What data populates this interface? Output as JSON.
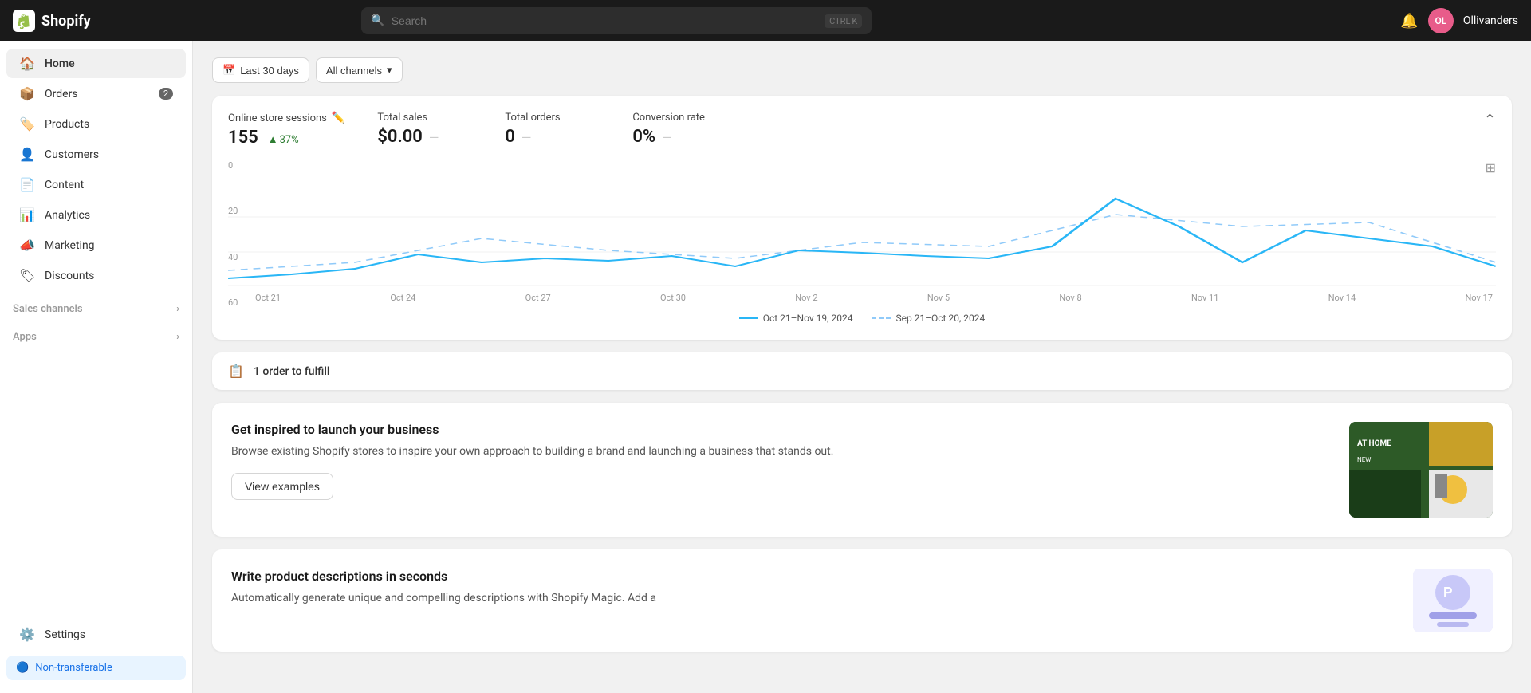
{
  "topbar": {
    "brand_name": "Shopify",
    "search_placeholder": "Search",
    "search_shortcut_key1": "CTRL",
    "search_shortcut_key2": "K",
    "user_initials": "OL",
    "user_name": "Ollivanders"
  },
  "sidebar": {
    "items": [
      {
        "id": "home",
        "label": "Home",
        "icon": "🏠",
        "badge": null
      },
      {
        "id": "orders",
        "label": "Orders",
        "icon": "📦",
        "badge": "2"
      },
      {
        "id": "products",
        "label": "Products",
        "icon": "🏷️",
        "badge": null
      },
      {
        "id": "customers",
        "label": "Customers",
        "icon": "👤",
        "badge": null
      },
      {
        "id": "content",
        "label": "Content",
        "icon": "📄",
        "badge": null
      },
      {
        "id": "analytics",
        "label": "Analytics",
        "icon": "📊",
        "badge": null
      },
      {
        "id": "marketing",
        "label": "Marketing",
        "icon": "📣",
        "badge": null
      },
      {
        "id": "discounts",
        "label": "Discounts",
        "icon": "🏷",
        "badge": null
      }
    ],
    "sales_channels_label": "Sales channels",
    "apps_label": "Apps",
    "settings_label": "Settings",
    "non_transferable_label": "Non-transferable"
  },
  "filters": {
    "date_range": "Last 30 days",
    "channel": "All channels"
  },
  "stats": {
    "online_sessions_label": "Online store sessions",
    "online_sessions_value": "155",
    "online_sessions_change": "37%",
    "online_sessions_change_dir": "up",
    "total_sales_label": "Total sales",
    "total_sales_value": "$0.00",
    "total_orders_label": "Total orders",
    "total_orders_value": "0",
    "conversion_rate_label": "Conversion rate",
    "conversion_rate_value": "0%"
  },
  "chart": {
    "y_labels": [
      "0",
      "20",
      "40",
      "60"
    ],
    "x_labels": [
      "Oct 21",
      "Oct 24",
      "Oct 27",
      "Oct 30",
      "Nov 2",
      "Nov 5",
      "Nov 8",
      "Nov 11",
      "Nov 14",
      "Nov 17"
    ],
    "legend_current": "Oct 21–Nov 19, 2024",
    "legend_previous": "Sep 21–Oct 20, 2024"
  },
  "fulfill": {
    "label": "1 order to fulfill"
  },
  "inspire": {
    "title": "Get inspired to launch your business",
    "description": "Browse existing Shopify stores to inspire your own approach to building a brand and launching a business that stands out.",
    "button_label": "View examples"
  },
  "write_product": {
    "title": "Write product descriptions in seconds",
    "description": "Automatically generate unique and compelling descriptions with Shopify Magic. Add a"
  }
}
